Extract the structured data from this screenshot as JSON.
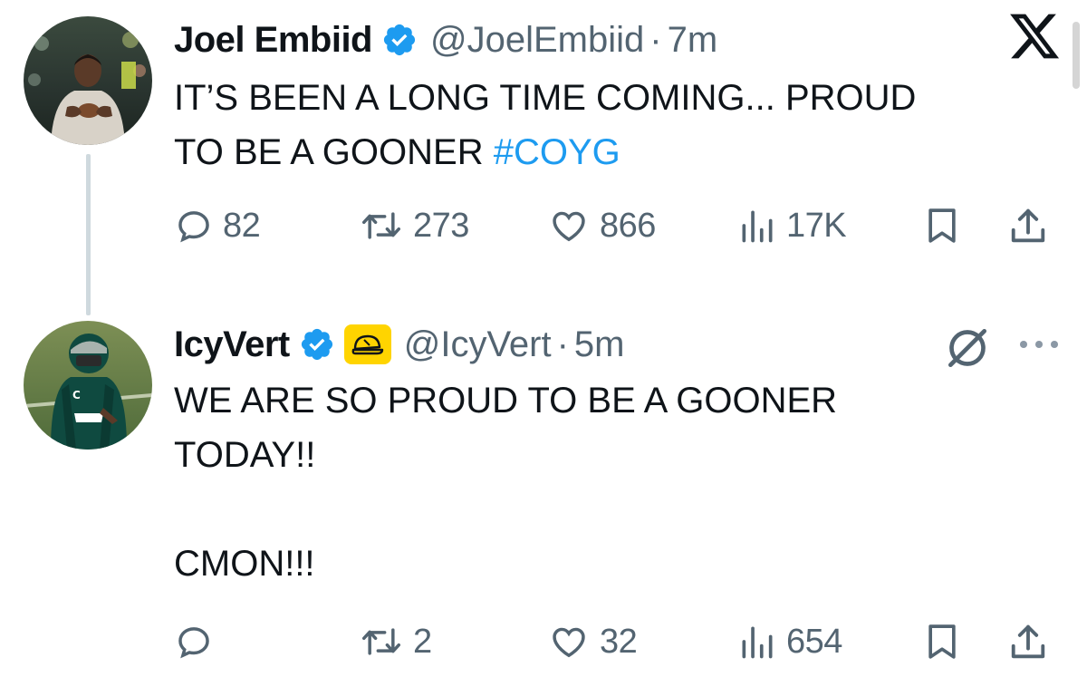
{
  "tweets": [
    {
      "author": {
        "display_name": "Joel Embiid",
        "handle": "@JoelEmbiid",
        "verified": true,
        "avatar": "player-in-hoodie-photo"
      },
      "time": "7m",
      "separator": "·",
      "text_main": "IT’S BEEN A LONG TIME COMING... PROUD\nTO BE A GOONER ",
      "hashtag": "#COYG",
      "top_right_icon": "x-logo-icon",
      "stats": {
        "replies": "82",
        "retweets": "273",
        "likes": "866",
        "views": "17K"
      }
    },
    {
      "author": {
        "display_name": "IcyVert",
        "handle": "@IcyVert",
        "verified": true,
        "affiliate_badge": "cap-icon",
        "avatar": "football-player-photo"
      },
      "time": "5m",
      "separator": "·",
      "text_main": "WE ARE SO PROUD TO BE A GOONER\nTODAY!!\n\nCMON!!!",
      "top_right_icons": [
        "grok-icon",
        "more-icon"
      ],
      "stats": {
        "replies": "",
        "retweets": "2",
        "likes": "32",
        "views": "654"
      }
    }
  ],
  "colors": {
    "text": "#0f1419",
    "secondary": "#536471",
    "hashtag": "#1d9bf0",
    "verified": "#1d9bf0",
    "affiliate_badge_bg": "#ffd400",
    "thread_line": "#cfd9de"
  }
}
